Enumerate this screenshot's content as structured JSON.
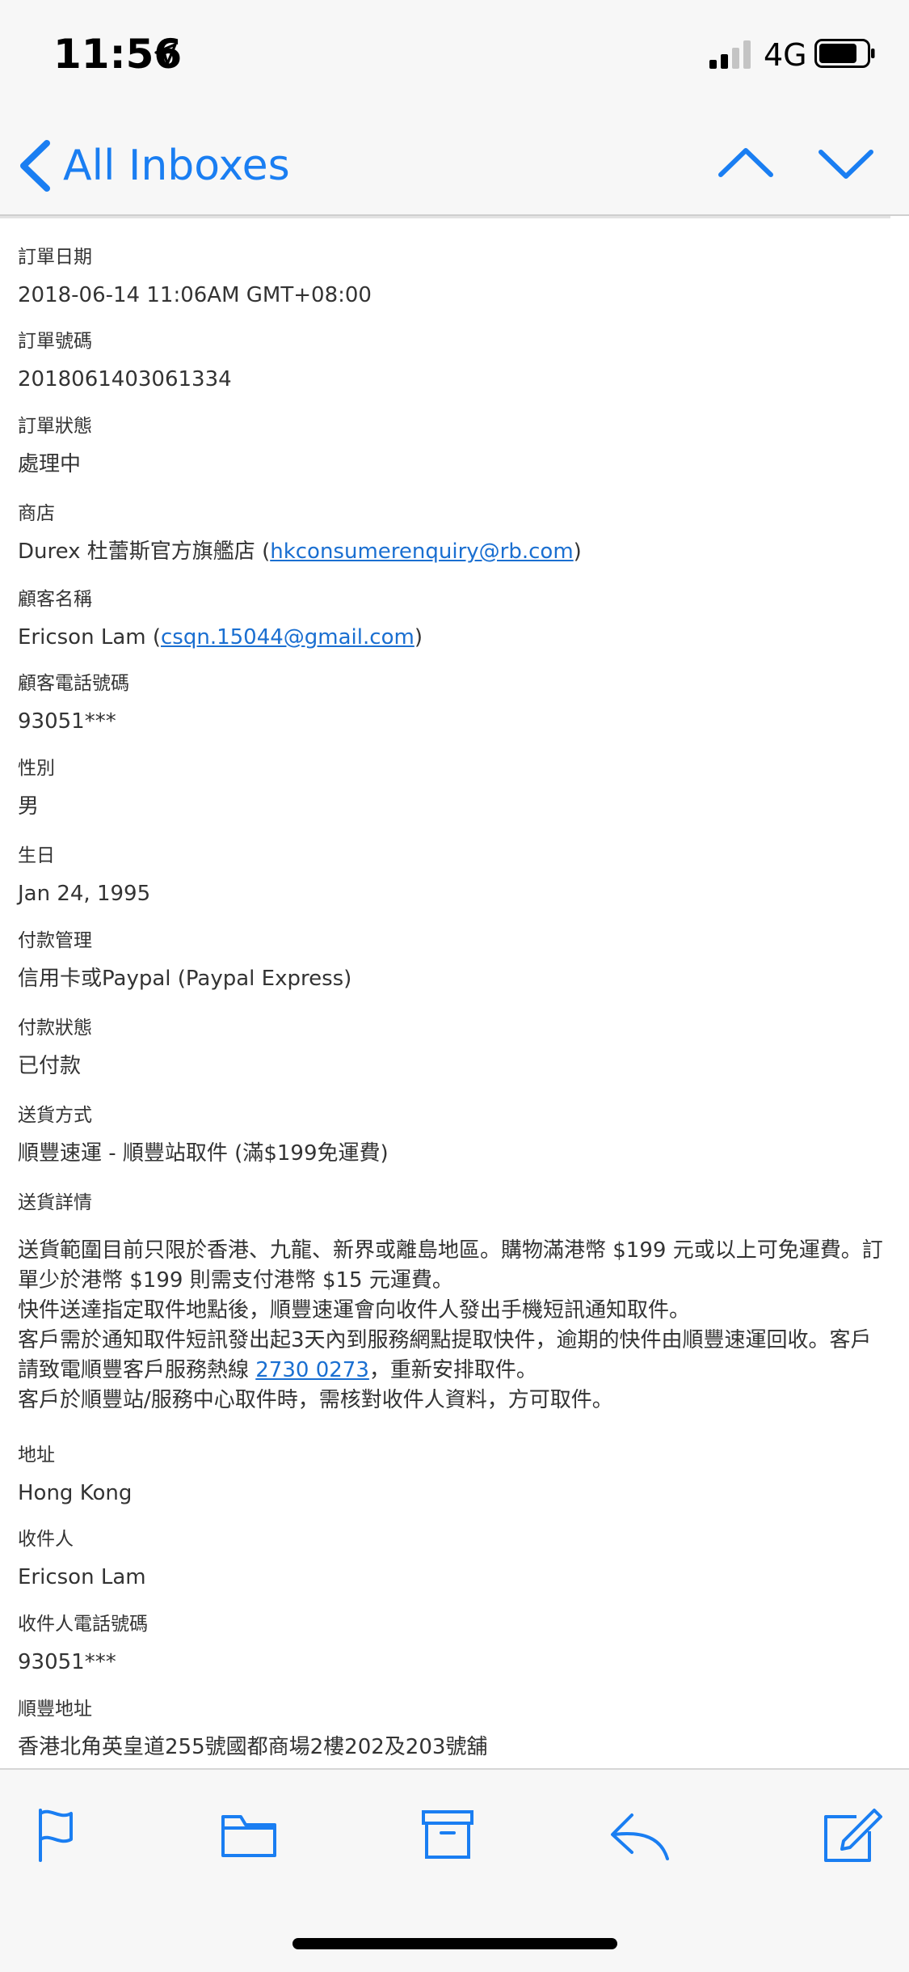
{
  "status_bar": {
    "time": "11:56",
    "network": "4G",
    "icons": [
      "location-arrow-icon",
      "signal-bars-icon",
      "battery-icon"
    ]
  },
  "nav": {
    "back_label": "All Inboxes",
    "icons": [
      "chevron-left-icon",
      "chevron-up-icon",
      "chevron-down-icon"
    ]
  },
  "colors": {
    "accent": "#1a7ef2",
    "link": "#1a6fd1",
    "bar_bg": "#f7f7f7",
    "text": "#333333"
  },
  "email": {
    "order_date": {
      "label": "訂單日期",
      "value": "2018-06-14 11:06AM GMT+08:00"
    },
    "order_number": {
      "label": "訂單號碼",
      "value": "2018061403061334"
    },
    "order_status": {
      "label": "訂單狀態",
      "value": "處理中"
    },
    "store": {
      "label": "商店",
      "prefix": "Durex 杜蕾斯官方旗艦店 (",
      "link": "hkconsumerenquiry@rb.com",
      "suffix": ")"
    },
    "customer_name": {
      "label": "顧客名稱",
      "prefix": "Ericson Lam (",
      "link": "csqn.15044@gmail.com",
      "suffix": ")"
    },
    "customer_phone": {
      "label": "顧客電話號碼",
      "value": "93051***"
    },
    "gender": {
      "label": "性別",
      "value": "男"
    },
    "birthday": {
      "label": "生日",
      "value": "Jan 24, 1995"
    },
    "payment_method": {
      "label": "付款管理",
      "value": "信用卡或Paypal (Paypal Express)"
    },
    "payment_status": {
      "label": "付款狀態",
      "value": "已付款"
    },
    "shipping_method": {
      "label": "送貨方式",
      "value": "順豐速運 - 順豐站取件 (滿$199免運費)"
    },
    "shipping_details": {
      "label": "送貨詳情",
      "line1": "送貨範圍目前只限於香港、九龍、新界或離島地區。購物滿港幣 $199 元或以上可免運費。訂單少於港幣 $199 則需支付港幣 $15 元運費。",
      "line2": "快件送達指定取件地點後，順豐速運會向收件人發出手機短訊通知取件。",
      "line3_prefix": "客戶需於通知取件短訊發出起3天內到服務網點提取快件，逾期的快件由順豐速運回收。客戶請致電順豐客戶服務熱線 ",
      "line3_link": "2730 0273",
      "line3_suffix": "，重新安排取件。",
      "line4": "客戶於順豐站/服務中心取件時，需核對收件人資料，方可取件。"
    },
    "address": {
      "label": "地址",
      "value": "Hong Kong"
    },
    "recipient": {
      "label": "收件人",
      "value": "Ericson Lam"
    },
    "recipient_phone": {
      "label": "收件人電話號碼",
      "value": "93051***"
    },
    "sf_address": {
      "label": "順豐地址",
      "value": "香港北角英皇道255號國都商場2樓202及203號舖"
    }
  },
  "toolbar": {
    "icons": [
      "flag-icon",
      "folder-icon",
      "archive-icon",
      "reply-icon",
      "compose-icon"
    ]
  }
}
